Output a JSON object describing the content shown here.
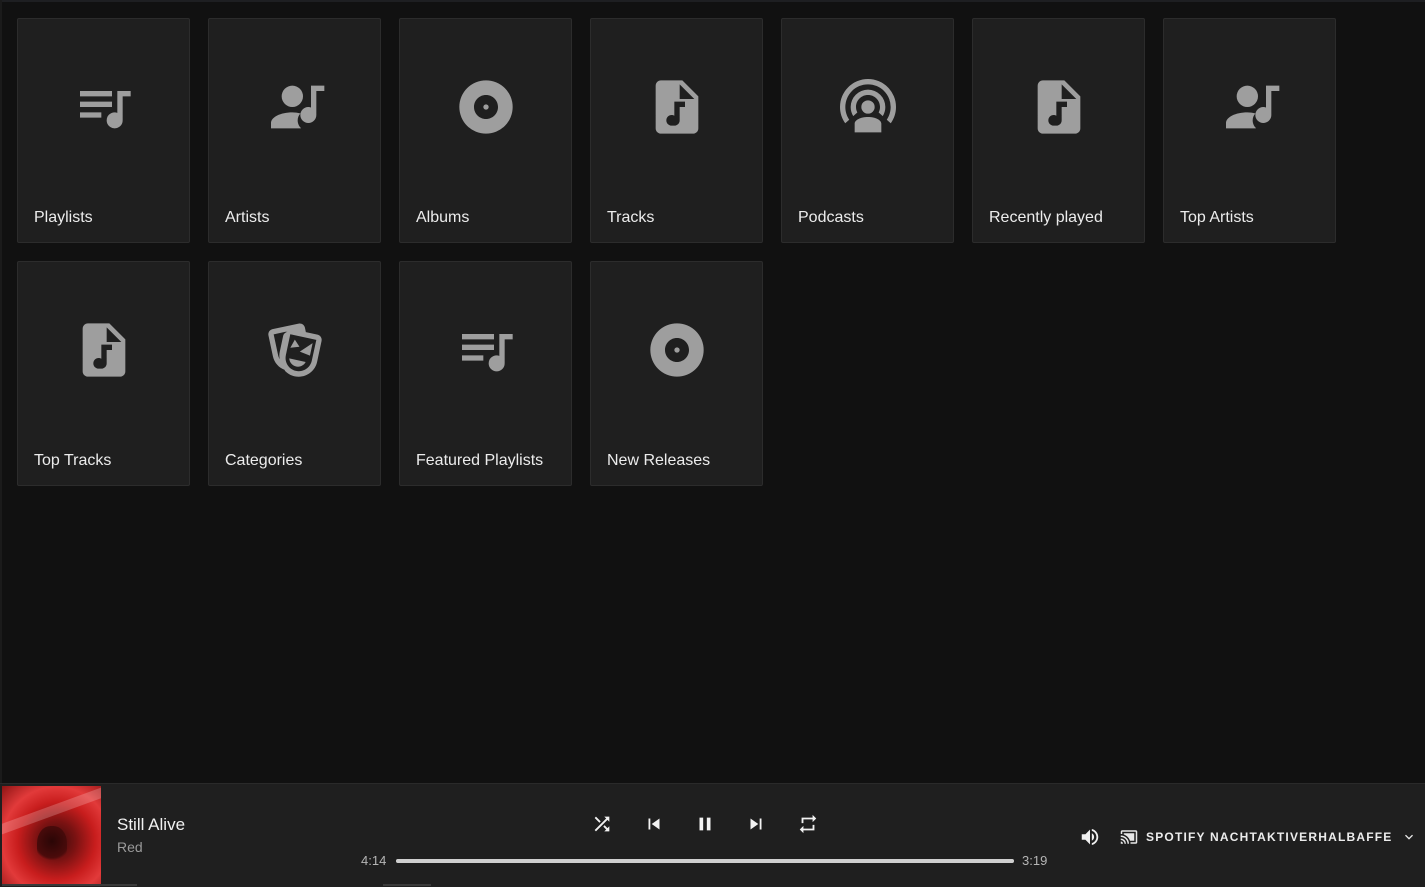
{
  "tiles": [
    {
      "label": "Playlists",
      "icon": "playlist-music-icon"
    },
    {
      "label": "Artists",
      "icon": "account-music-icon"
    },
    {
      "label": "Albums",
      "icon": "album-icon"
    },
    {
      "label": "Tracks",
      "icon": "file-music-icon"
    },
    {
      "label": "Podcasts",
      "icon": "podcast-icon"
    },
    {
      "label": "Recently played",
      "icon": "file-music-icon"
    },
    {
      "label": "Top Artists",
      "icon": "account-music-icon"
    },
    {
      "label": "Top Tracks",
      "icon": "file-music-icon"
    },
    {
      "label": "Categories",
      "icon": "drama-masks-icon"
    },
    {
      "label": "Featured Playlists",
      "icon": "playlist-music-icon"
    },
    {
      "label": "New Releases",
      "icon": "album-icon"
    }
  ],
  "player": {
    "title": "Still Alive",
    "artist": "Red",
    "elapsed": "4:14",
    "duration": "3:19",
    "progress_fraction": 1.0,
    "device_name": "SPOTIFY NACHTAKTIVERHALBAFFE",
    "controls": [
      "shuffle-icon",
      "skip-previous-icon",
      "pause-icon",
      "skip-next-icon",
      "repeat-icon"
    ]
  },
  "colors": {
    "background": "#111111",
    "tile": "#1f1f1f",
    "icon": "#9e9e9e",
    "player_bar": "#1f1f1f",
    "cover_accent": "#c81d1d"
  }
}
